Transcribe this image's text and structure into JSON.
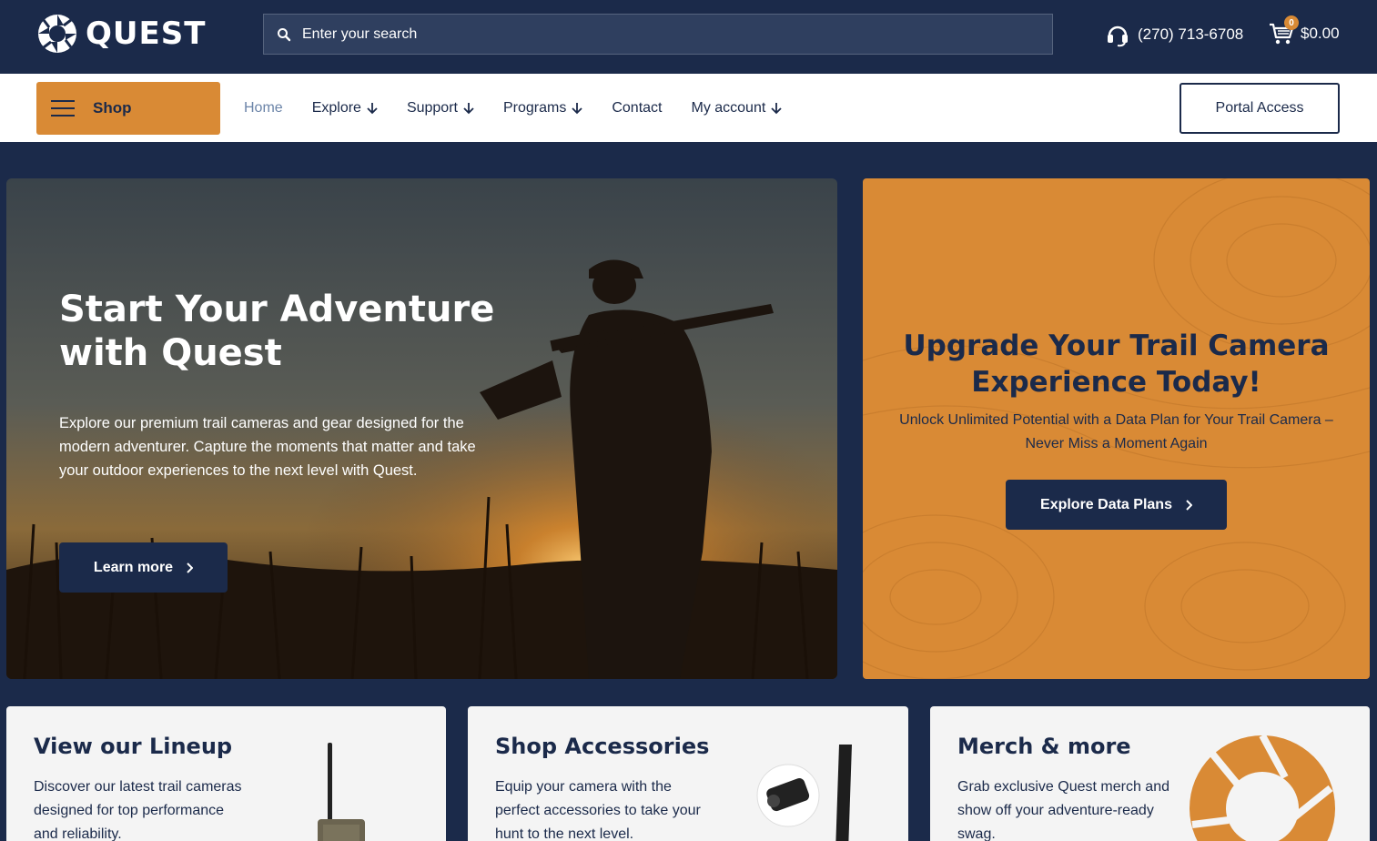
{
  "header": {
    "logo_text": "QUEST",
    "search_placeholder": "Enter your search",
    "phone": "(270) 713-6708",
    "cart_count": "0",
    "cart_total": "$0.00"
  },
  "nav": {
    "shop_label": "Shop",
    "items": [
      {
        "label": "Home",
        "active": true,
        "has_dropdown": false
      },
      {
        "label": "Explore",
        "active": false,
        "has_dropdown": true
      },
      {
        "label": "Support",
        "active": false,
        "has_dropdown": true
      },
      {
        "label": "Programs",
        "active": false,
        "has_dropdown": true
      },
      {
        "label": "Contact",
        "active": false,
        "has_dropdown": false
      },
      {
        "label": "My account",
        "active": false,
        "has_dropdown": true
      }
    ],
    "portal_label": "Portal Access"
  },
  "hero": {
    "title": "Start Your Adventure with Quest",
    "text": "Explore our premium trail cameras and gear designed for the modern adventurer. Capture the moments that matter and take your outdoor experiences to the next level with Quest.",
    "button_label": "Learn more"
  },
  "promo": {
    "title": "Upgrade Your Trail Camera Experience Today!",
    "subtitle": "Unlock Unlimited Potential with a Data Plan for Your Trail Camera – Never Miss a Moment Again",
    "button_label": "Explore Data Plans"
  },
  "cards": [
    {
      "title": "View our Lineup",
      "text": "Discover our latest trail cameras designed for top performance and reliability."
    },
    {
      "title": "Shop Accessories",
      "text": "Equip your camera with the perfect accessories to take your hunt to the next level."
    },
    {
      "title": "Merch & more",
      "text": "Grab exclusive Quest merch and show off your adventure-ready swag."
    }
  ],
  "colors": {
    "navy": "#1b2a4a",
    "orange": "#d98a35",
    "white": "#ffffff",
    "card_bg": "#f4f4f4"
  },
  "icons": {
    "search": "search-icon",
    "phone": "headset-icon",
    "cart": "cart-icon",
    "menu": "hamburger-icon",
    "dropdown": "arrow-down-icon",
    "chevron": "chevron-right-icon"
  }
}
